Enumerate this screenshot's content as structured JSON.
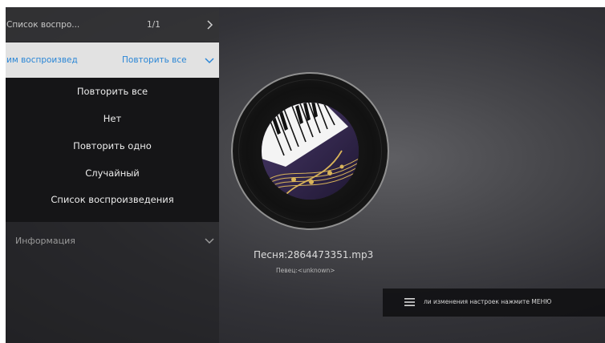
{
  "playlist_row": {
    "label": "Список воспро...",
    "value": "1/1",
    "icon": "chevron-right-icon"
  },
  "mode_row": {
    "label": "им воспроизвед",
    "value": "Повторить все",
    "icon": "chevron-down-icon"
  },
  "mode_options": [
    "Повторить все",
    "Нет",
    "Повторить одно",
    "Случайный",
    "Список воспроизведения"
  ],
  "info_row": {
    "label": "Информация",
    "icon": "chevron-down-icon"
  },
  "now_playing": {
    "song": "Песня:2864473351.mp3",
    "artist": "Певец:<unknown>"
  },
  "hint": {
    "icon": "menu-icon",
    "text": "ли изменения настроек нажмите МЕНЮ"
  },
  "colors": {
    "accent": "#2a86d6",
    "selected_row_bg": "#e2e2e2",
    "dropdown_bg": "#151517"
  }
}
